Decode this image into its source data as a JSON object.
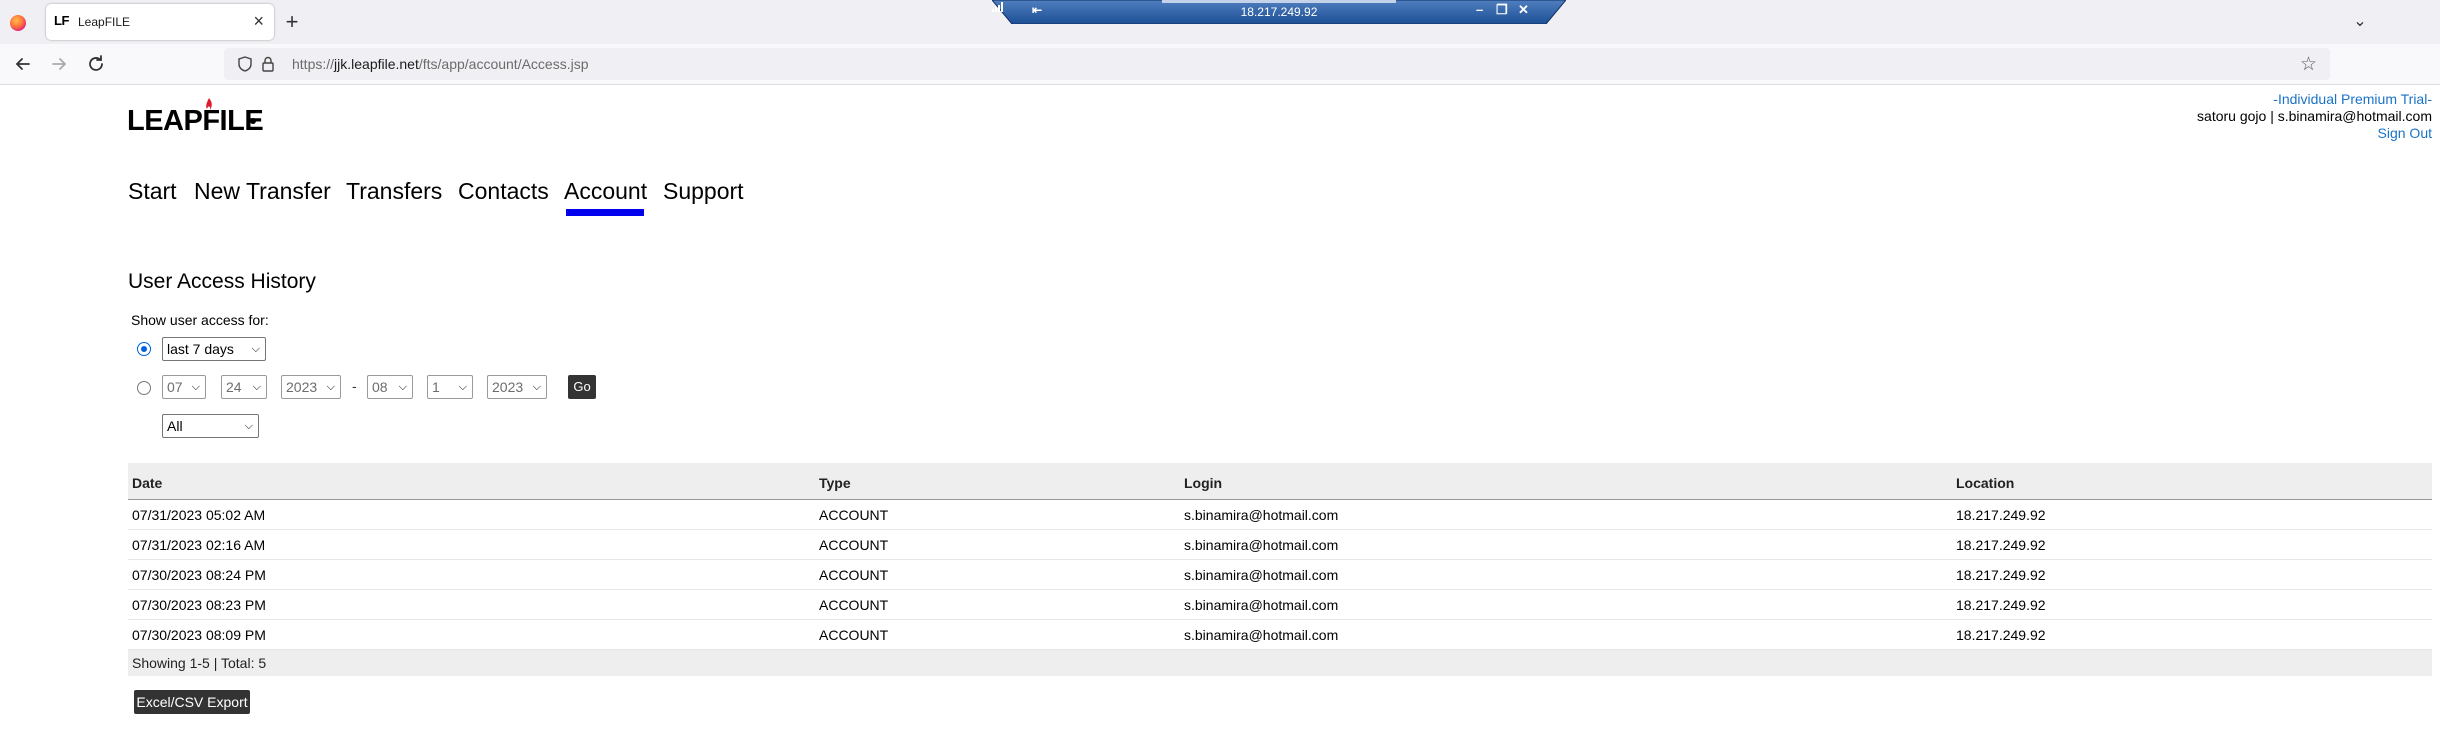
{
  "browser": {
    "tab_favicon": "LF",
    "tab_title": "LeapFILE",
    "tab_close": "×",
    "new_tab": "+",
    "tab_list": "⌄",
    "url_prefix": "https://",
    "url_host": "jjk.leapfile.net",
    "url_path": "/fts/app/account/Access.jsp",
    "icons": {
      "back": "arrow-left",
      "forward": "arrow-right",
      "reload": "reload",
      "bookmark": "star"
    }
  },
  "remote_session": {
    "host": "18.217.249.92",
    "controls": [
      "–",
      "❐",
      "✕"
    ]
  },
  "logo_text": "LEAPFILE",
  "account": {
    "plan": "-Individual Premium Trial-",
    "user": "satoru gojo | s.binamira@hotmail.com",
    "sign_out": "Sign Out"
  },
  "main_nav": [
    {
      "label": "Start"
    },
    {
      "label": "New Transfer"
    },
    {
      "label": "Transfers"
    },
    {
      "label": "Contacts"
    },
    {
      "label": "Account",
      "active": true
    },
    {
      "label": "Support"
    }
  ],
  "section_title": "User Access History",
  "filter": {
    "show_label": "Show user access for:",
    "preset_value": "last 7 days",
    "from_month": "07",
    "from_day": "24",
    "from_year": "2023",
    "separator": "-",
    "to_month": "08",
    "to_day": "1",
    "to_year": "2023",
    "go_label": "Go",
    "type_value": "All"
  },
  "table": {
    "headers": [
      "Date",
      "Type",
      "Login",
      "Location"
    ],
    "rows": [
      [
        "07/31/2023 05:02 AM",
        "ACCOUNT",
        "s.binamira@hotmail.com",
        "18.217.249.92"
      ],
      [
        "07/31/2023 02:16 AM",
        "ACCOUNT",
        "s.binamira@hotmail.com",
        "18.217.249.92"
      ],
      [
        "07/30/2023 08:24 PM",
        "ACCOUNT",
        "s.binamira@hotmail.com",
        "18.217.249.92"
      ],
      [
        "07/30/2023 08:23 PM",
        "ACCOUNT",
        "s.binamira@hotmail.com",
        "18.217.249.92"
      ],
      [
        "07/30/2023 08:09 PM",
        "ACCOUNT",
        "s.binamira@hotmail.com",
        "18.217.249.92"
      ]
    ],
    "footer": "Showing 1-5 | Total: 5"
  },
  "export_label": "Excel/CSV Export",
  "colors": {
    "accent_link": "#1a73c7",
    "active_tab_bar": "#0000ee",
    "button_bg": "#333333",
    "table_header_bg": "#eeeeee"
  }
}
